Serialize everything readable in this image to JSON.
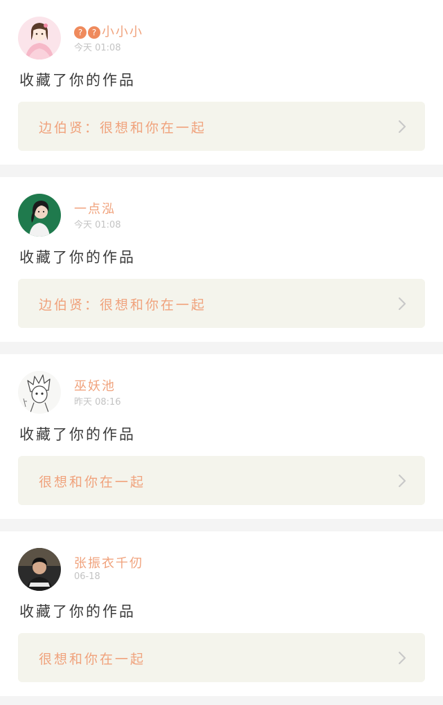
{
  "feed": [
    {
      "username_prefix_glyphs": [
        "?",
        "?"
      ],
      "username": "小小小",
      "time": "今天 01:08",
      "action": "收藏了你的作品",
      "work_title": "边伯贤：很想和你在一起",
      "avatar": "girl-pink-dress-avatar"
    },
    {
      "username": "一点泓",
      "time": "今天 01:08",
      "action": "收藏了你的作品",
      "work_title": "边伯贤：很想和你在一起",
      "avatar": "woman-green-background-avatar"
    },
    {
      "username": "巫妖池",
      "time": "昨天 08:16",
      "action": "收藏了你的作品",
      "work_title": "很想和你在一起",
      "avatar": "anime-sketch-avatar"
    },
    {
      "username": "张振衣千仞",
      "time": "06-18",
      "action": "收藏了你的作品",
      "work_title": "很想和你在一起",
      "avatar": "man-dark-photo-avatar"
    }
  ],
  "colors": {
    "accent": "#f0a27c",
    "box_background": "#f4f4ec",
    "separator": "#f4f4f4",
    "timestamp": "#c3c3c3",
    "body_text": "#3a3a3a"
  },
  "icons": {
    "chevron": "chevron-right-icon"
  }
}
